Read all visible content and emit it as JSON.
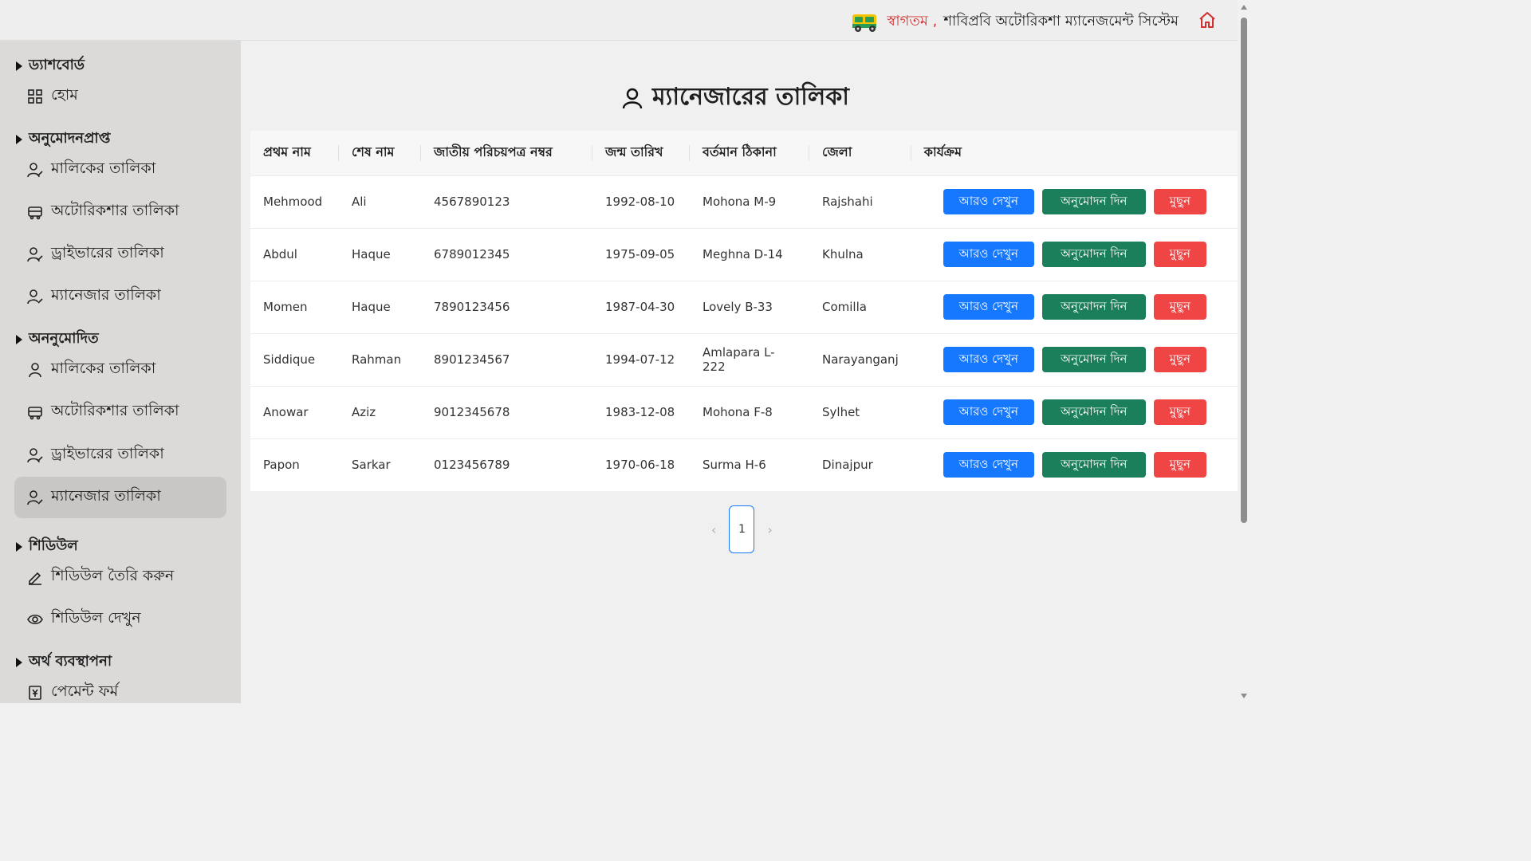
{
  "header": {
    "welcome": "স্বাগতম ,",
    "system_name": "শাবিপ্রবি অটোরিকশা ম্যানেজমেন্ট সিস্টেম",
    "welcome_color": "#d32f2f",
    "home_icon": "home-icon"
  },
  "sidebar": {
    "sections": [
      {
        "title": "ড্যাশবোর্ড",
        "items": [
          {
            "label": "হোম",
            "icon": "grid-icon"
          }
        ]
      },
      {
        "title": "অনুমোদনপ্রাপ্ত",
        "items": [
          {
            "label": "মালিকের তালিকা",
            "icon": "user-check-icon"
          },
          {
            "label": "অটোরিকশার তালিকা",
            "icon": "vehicle-icon"
          },
          {
            "label": "ড্রাইভারের তালিকা",
            "icon": "user-check-icon"
          },
          {
            "label": "ম্যানেজার তালিকা",
            "icon": "user-edit-icon"
          }
        ]
      },
      {
        "title": "অননুমোদিত",
        "items": [
          {
            "label": "মালিকের তালিকা",
            "icon": "user-icon"
          },
          {
            "label": "অটোরিকশার তালিকা",
            "icon": "vehicle-icon"
          },
          {
            "label": "ড্রাইভারের তালিকা",
            "icon": "user-check-icon"
          },
          {
            "label": "ম্যানেজার তালিকা",
            "icon": "user-edit-icon",
            "active": true
          }
        ]
      },
      {
        "title": "শিডিউল",
        "items": [
          {
            "label": "শিডিউল তৈরি করুন",
            "icon": "pencil-icon"
          },
          {
            "label": "শিডিউল দেখুন",
            "icon": "eye-icon"
          }
        ]
      },
      {
        "title": "অর্থ ব্যবস্থাপনা",
        "items": [
          {
            "label": "পেমেন্ট ফর্ম",
            "icon": "yen-receipt-icon"
          }
        ]
      }
    ]
  },
  "main": {
    "title": "ম্যানেজারের তালিকা",
    "table": {
      "headers": [
        "প্রথম নাম",
        "শেষ নাম",
        "জাতীয় পরিচয়পত্র নম্বর",
        "জন্ম তারিখ",
        "বর্তমান ঠিকানা",
        "জেলা",
        "কার্যক্রম"
      ],
      "rows": [
        [
          "Mehmood",
          "Ali",
          "4567890123",
          "1992-08-10",
          "Mohona M-9",
          "Rajshahi"
        ],
        [
          "Abdul",
          "Haque",
          "6789012345",
          "1975-09-05",
          "Meghna D-14",
          "Khulna"
        ],
        [
          "Momen",
          "Haque",
          "7890123456",
          "1987-04-30",
          "Lovely B-33",
          "Comilla"
        ],
        [
          "Siddique",
          "Rahman",
          "8901234567",
          "1994-07-12",
          "Amlapara L-222",
          "Narayanganj"
        ],
        [
          "Anowar",
          "Aziz",
          "9012345678",
          "1983-12-08",
          "Mohona F-8",
          "Sylhet"
        ],
        [
          "Papon",
          "Sarkar",
          "0123456789",
          "1970-06-18",
          "Surma H-6",
          "Dinajpur"
        ]
      ],
      "actions": {
        "view": "আরও দেখুন",
        "approve": "অনুমোদন দিন",
        "delete": "মুছুন"
      }
    },
    "pagination": {
      "current": "1",
      "prev": "‹",
      "next": "›"
    },
    "colors": {
      "blue": "#1677ff",
      "green": "#1a7f5a",
      "red": "#f04545"
    }
  }
}
